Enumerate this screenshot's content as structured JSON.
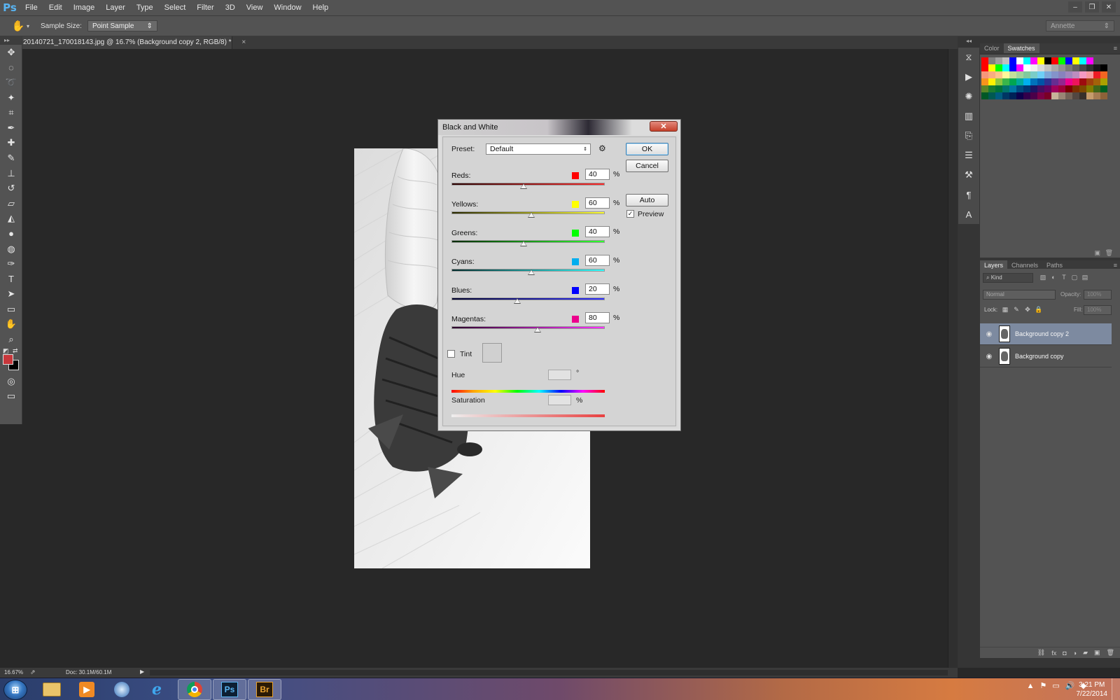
{
  "app": {
    "logo": "Ps"
  },
  "menubar": {
    "items": [
      "File",
      "Edit",
      "Image",
      "Layer",
      "Type",
      "Select",
      "Filter",
      "3D",
      "View",
      "Window",
      "Help"
    ],
    "window_controls": [
      "minimize-icon",
      "restore-icon",
      "close-icon"
    ]
  },
  "options_bar": {
    "tool_icon": "hand-icon",
    "sample_size_label": "Sample Size:",
    "sample_size_value": "Point Sample",
    "workspace_value": "Annette"
  },
  "tools": [
    "move-icon",
    "marquee-icon",
    "lasso-icon",
    "magic-wand-icon",
    "crop-icon",
    "eyedropper-icon",
    "healing-brush-icon",
    "brush-icon",
    "clone-stamp-icon",
    "history-brush-icon",
    "eraser-icon",
    "paint-bucket-icon",
    "blur-icon",
    "dodge-icon",
    "pen-icon",
    "type-icon",
    "path-selection-icon",
    "rectangle-icon",
    "hand-icon",
    "zoom-icon"
  ],
  "colors": {
    "foreground": "#c8373b",
    "background": "#000000"
  },
  "document": {
    "tab_title": "20140721_170018143.jpg @ 16.7% (Background copy 2, RGB/8) *",
    "tab_close": "×"
  },
  "dialog": {
    "title": "Black and White",
    "close_label": "✕",
    "preset_label": "Preset:",
    "preset_value": "Default",
    "ok_label": "OK",
    "cancel_label": "Cancel",
    "auto_label": "Auto",
    "preview_label": "Preview",
    "preview_checked": true,
    "percent_symbol": "%",
    "channels": [
      {
        "label": "Reds:",
        "value": "40",
        "color": "#ff0000",
        "track": [
          "#2a0000",
          "#ff2a2a"
        ],
        "fraction": 0.47
      },
      {
        "label": "Yellows:",
        "value": "60",
        "color": "#ffff00",
        "track": [
          "#2a2a00",
          "#ffff30"
        ],
        "fraction": 0.52
      },
      {
        "label": "Greens:",
        "value": "40",
        "color": "#00ff00",
        "track": [
          "#002a00",
          "#30ff30"
        ],
        "fraction": 0.47
      },
      {
        "label": "Cyans:",
        "value": "60",
        "color": "#00aeef",
        "track": [
          "#002a2a",
          "#30ffff"
        ],
        "fraction": 0.52
      },
      {
        "label": "Blues:",
        "value": "20",
        "color": "#0000ff",
        "track": [
          "#00002a",
          "#3030ff"
        ],
        "fraction": 0.43
      },
      {
        "label": "Magentas:",
        "value": "80",
        "color": "#ec008c",
        "track": [
          "#2a002a",
          "#ff30ff"
        ],
        "fraction": 0.56
      }
    ],
    "tint_label": "Tint",
    "tint_checked": false,
    "hue_label": "Hue",
    "hue_unit": "°",
    "saturation_label": "Saturation",
    "saturation_unit": "%"
  },
  "dock_icons": [
    "history-icon",
    "actions-icon",
    "brush-presets-icon",
    "adjustments-icon",
    "clone-source-icon",
    "properties-icon",
    "tool-presets-icon",
    "paragraph-icon",
    "character-icon"
  ],
  "swatch_panel": {
    "tabs": [
      "Color",
      "Swatches"
    ],
    "active_tab": "Swatches",
    "rows": [
      [
        "#ff0000",
        "#808080",
        "#a0a0a0",
        "#c0c0c0",
        "#0000ff",
        "#ffffff",
        "#00ffff",
        "#ff00ff",
        "#ffff00",
        "#000000",
        "#ff0000",
        "#00ff00",
        "#0000ff",
        "#ffff00",
        "#00ffff",
        "#ff00ff"
      ],
      [
        "#ff0000",
        "#ffff00",
        "#00ff00",
        "#00ffff",
        "#0000ff",
        "#ff00ff",
        "#ffffff",
        "#f0f0f0",
        "#d8d8d8",
        "#c0c0c0",
        "#a8a8a8",
        "#909090",
        "#787878",
        "#606060",
        "#484848",
        "#303030",
        "#181818",
        "#000000"
      ],
      [
        "#f7977a",
        "#f9ad81",
        "#fdc68a",
        "#fff79a",
        "#c4df9b",
        "#a2d39c",
        "#82ca9d",
        "#7bcdc8",
        "#6ecff6",
        "#7ea7d8",
        "#8493ca",
        "#8882be",
        "#a187be",
        "#bc8dbf",
        "#f49ac2",
        "#f6989d",
        "#ed1c24",
        "#f26522"
      ],
      [
        "#f7941d",
        "#fff200",
        "#8dc63f",
        "#39b54a",
        "#00a651",
        "#00a99d",
        "#00aeef",
        "#0072bc",
        "#0054a6",
        "#2e3192",
        "#662d91",
        "#92278f",
        "#ec008c",
        "#ed145b",
        "#9e0b0f",
        "#a0410d",
        "#a36209",
        "#aba000"
      ],
      [
        "#598527",
        "#1a7b30",
        "#007236",
        "#00746b",
        "#0076a3",
        "#004b80",
        "#003471",
        "#1b1464",
        "#440e62",
        "#630460",
        "#9e005d",
        "#9e0039",
        "#790000",
        "#7b2e00",
        "#7d4900",
        "#827b00",
        "#406618",
        "#005e20"
      ],
      [
        "#005826",
        "#005952",
        "#005b7f",
        "#003663",
        "#002157",
        "#0d004c",
        "#32004b",
        "#4b0049",
        "#7b0046",
        "#7a0026",
        "#c7b299",
        "#998675",
        "#736357",
        "#534741",
        "#37302a",
        "#c69c6d",
        "#a67c52",
        "#8c6239"
      ]
    ]
  },
  "layers_panel": {
    "tabs": [
      "Layers",
      "Channels",
      "Paths"
    ],
    "active_tab": "Layers",
    "filter_placeholder": "Kind",
    "blend_mode": "Normal",
    "opacity_label": "Opacity:",
    "opacity_value": "100%",
    "lock_label": "Lock:",
    "fill_label": "Fill:",
    "fill_value": "100%",
    "layers": [
      {
        "name": "Background copy 2",
        "selected": true
      },
      {
        "name": "Background copy",
        "selected": false
      }
    ]
  },
  "statusbar": {
    "zoom": "16.67%",
    "doc_info": "Doc: 30.1M/60.1M"
  },
  "taskbar": {
    "apps": [
      "windows-explorer-icon",
      "media-player-icon",
      "network-icon",
      "internet-explorer-icon",
      "chrome-icon",
      "photoshop-icon",
      "bridge-icon"
    ],
    "ps_label": "Ps",
    "br_label": "Br",
    "time": "3:21 PM",
    "date": "7/22/2014"
  }
}
